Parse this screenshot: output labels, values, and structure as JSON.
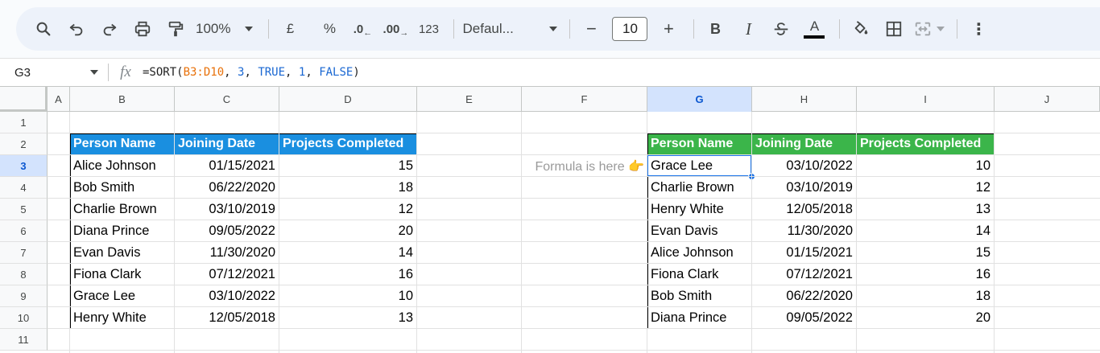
{
  "toolbar": {
    "zoom": "100%",
    "currency": "£",
    "percent": "%",
    "dec_decrease": ".0",
    "dec_increase": ".00",
    "number_format": "123",
    "font": "Defaul...",
    "font_size": "10",
    "minus": "−",
    "plus": "+",
    "bold": "B",
    "italic": "I",
    "text_color": "A",
    "more": "⋮"
  },
  "formula_bar": {
    "cell_ref": "G3",
    "formula_prefix": "=SORT(",
    "formula_range": "B3:D10",
    "formula_sep1": ", ",
    "formula_arg1": "3",
    "formula_sep2": ", ",
    "formula_arg2": "TRUE",
    "formula_sep3": ", ",
    "formula_arg3": "1",
    "formula_sep4": ", ",
    "formula_arg4": "FALSE",
    "formula_suffix": ")"
  },
  "columns": [
    "A",
    "B",
    "C",
    "D",
    "E",
    "F",
    "G",
    "H",
    "I",
    "J"
  ],
  "rows": [
    "1",
    "2",
    "3",
    "4",
    "5",
    "6",
    "7",
    "8",
    "9",
    "10",
    "11"
  ],
  "note": "Formula is here 👉",
  "source_table": {
    "headers": [
      "Person Name",
      "Joining Date",
      "Projects Completed"
    ],
    "rows": [
      [
        "Alice Johnson",
        "01/15/2021",
        "15"
      ],
      [
        "Bob Smith",
        "06/22/2020",
        "18"
      ],
      [
        "Charlie Brown",
        "03/10/2019",
        "12"
      ],
      [
        "Diana Prince",
        "09/05/2022",
        "20"
      ],
      [
        "Evan Davis",
        "11/30/2020",
        "14"
      ],
      [
        "Fiona Clark",
        "07/12/2021",
        "16"
      ],
      [
        "Grace Lee",
        "03/10/2022",
        "10"
      ],
      [
        "Henry White",
        "12/05/2018",
        "13"
      ]
    ]
  },
  "sorted_table": {
    "headers": [
      "Person Name",
      "Joining Date",
      "Projects Completed"
    ],
    "rows": [
      [
        "Grace Lee",
        "03/10/2022",
        "10"
      ],
      [
        "Charlie Brown",
        "03/10/2019",
        "12"
      ],
      [
        "Henry White",
        "12/05/2018",
        "13"
      ],
      [
        "Evan Davis",
        "11/30/2020",
        "14"
      ],
      [
        "Alice Johnson",
        "01/15/2021",
        "15"
      ],
      [
        "Fiona Clark",
        "07/12/2021",
        "16"
      ],
      [
        "Bob Smith",
        "06/22/2020",
        "18"
      ],
      [
        "Diana Prince",
        "09/05/2022",
        "20"
      ]
    ]
  },
  "colors": {
    "source_header": "#1a8fe0",
    "sorted_header": "#3bb54a",
    "selection": "#1a73e8"
  }
}
